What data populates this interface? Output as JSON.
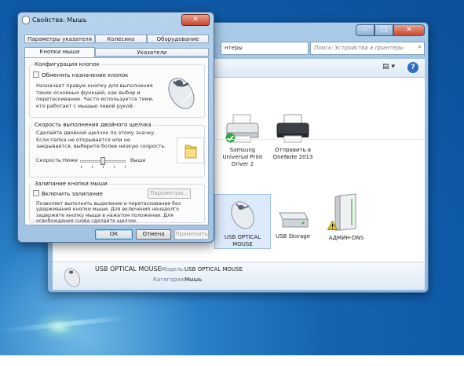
{
  "devices_window": {
    "address_fragment": "нтеры",
    "search_placeholder": "Поиск: Устройства и принтеры",
    "buttons": {
      "minimize": "–",
      "maximize": "□",
      "close": "✕"
    },
    "printers": [
      {
        "label": "Samsung Universal Print Driver 2",
        "label_lines": [
          "Samsung",
          "Universal Print",
          "Driver 2"
        ],
        "icon": "printer-icon",
        "default": true
      },
      {
        "label": "Отправить в OneNote 2013",
        "label_lines": [
          "Отправить в",
          "OneNote 2013"
        ],
        "icon": "printer-icon"
      }
    ],
    "devices": [
      {
        "label": "USB OPTICAL MOUSE",
        "label_lines": [
          "USB OPTICAL",
          "MOUSE"
        ],
        "icon": "mouse-icon",
        "selected": true
      },
      {
        "label": "USB Storage",
        "icon": "usb-drive-icon"
      },
      {
        "label": "АДМИН-DNS",
        "icon": "computer-tower-icon",
        "warning": true
      }
    ],
    "details": {
      "name": "USB OPTICAL MOUSE",
      "model_key": "Модель:",
      "model_value": "USB OPTICAL MOUSE",
      "category_key": "Категория:",
      "category_value": "Мышь"
    }
  },
  "dialog": {
    "title": "Свойства: Мышь",
    "close": "✕",
    "tabs_back": [
      "Параметры указателя",
      "Колесико",
      "Оборудование"
    ],
    "tabs_front": [
      "Кнопки мыши",
      "Указатели"
    ],
    "active_tab": "Кнопки мыши",
    "button_config": {
      "title": "Конфигурация кнопок",
      "checkbox": "Обменять назначение кнопок",
      "description": [
        "Назначает правую кнопку для выполнения",
        "таких основных функций, как выбор и",
        "перетаскивание. Часто используется теми,",
        "кто работает с мышью левой рукой."
      ]
    },
    "double_click": {
      "title": "Скорость выполнения двойного щелчка",
      "description": [
        "Сделайте двойной щелчок по этому значку.",
        "Если папка не открывается или не",
        "закрывается, выберите более низкую скорость."
      ],
      "speed_label": "Скорость:",
      "low": "Ниже",
      "high": "Выше",
      "speed_level": 0.5
    },
    "click_lock": {
      "title": "Залипание кнопки мыши",
      "checkbox": "Включить залипание",
      "settings_button": "Параметры...",
      "description": [
        "Позволяет выполнять выделение и перетаскивание без",
        "удерживания кнопки мыши. Для включения ненадолго",
        "задержите кнопку мыши в нажатом положении. Для",
        "освобождения снова сделайте щелчок."
      ]
    },
    "buttons": {
      "ok": "ОК",
      "cancel": "Отмена",
      "apply": "Применить"
    }
  }
}
